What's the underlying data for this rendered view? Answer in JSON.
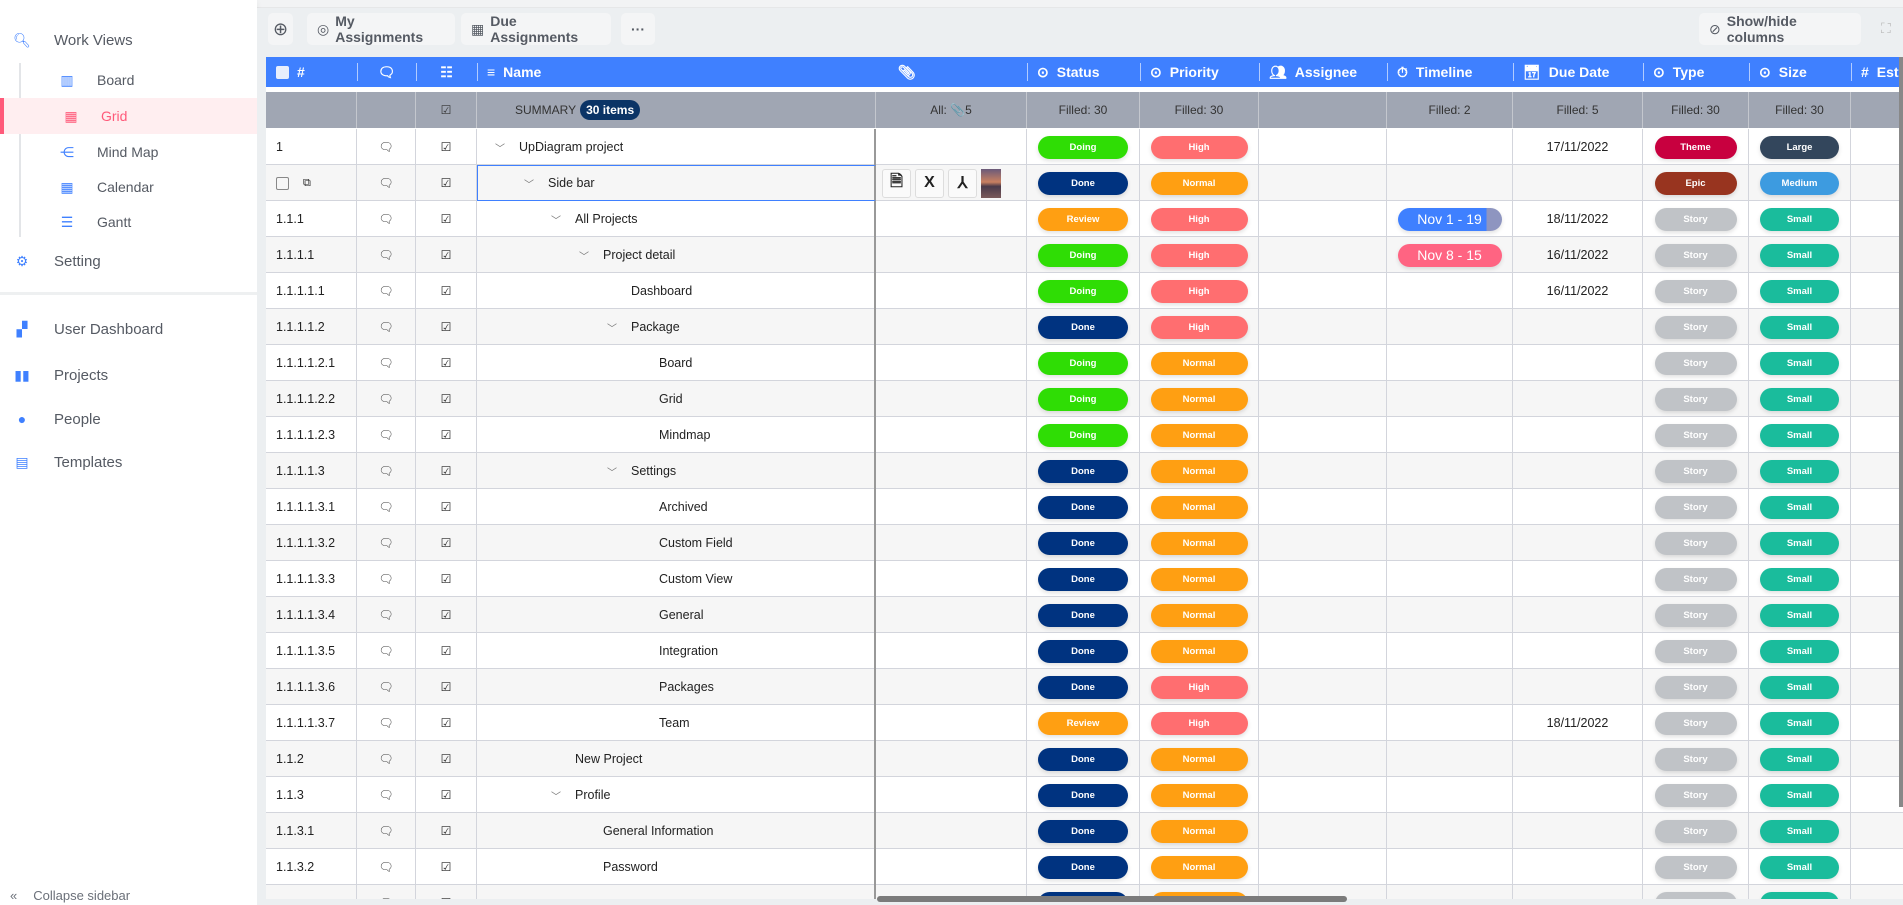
{
  "sidebar": {
    "work_views": "Work Views",
    "views": [
      {
        "label": "Board",
        "icon": "board-icon",
        "glyph": "▥"
      },
      {
        "label": "Grid",
        "icon": "grid-icon",
        "glyph": "▦",
        "active": true
      },
      {
        "label": "Mind Map",
        "icon": "mind-map-icon",
        "glyph": "⋲"
      },
      {
        "label": "Calendar",
        "icon": "calendar-icon",
        "glyph": "▦"
      },
      {
        "label": "Gantt",
        "icon": "gantt-icon",
        "glyph": "☰"
      }
    ],
    "setting": "Setting",
    "items": [
      {
        "label": "User Dashboard",
        "icon": "dashboard-icon",
        "glyph": "▞"
      },
      {
        "label": "Projects",
        "icon": "book-icon",
        "glyph": "▮▮"
      },
      {
        "label": "People",
        "icon": "person-icon",
        "glyph": "●"
      },
      {
        "label": "Templates",
        "icon": "clipboard-icon",
        "glyph": "▤"
      }
    ],
    "collapse": "Collapse sidebar"
  },
  "toolbar": {
    "my_assignments": "My Assignments",
    "due_assignments": "Due Assignments",
    "more": "···",
    "show_hide": "Show/hide columns"
  },
  "columns": {
    "num": "#",
    "name": "Name",
    "status": "Status",
    "priority": "Priority",
    "assignee": "Assignee",
    "timeline": "Timeline",
    "due_date": "Due Date",
    "type": "Type",
    "size": "Size",
    "estimate": "Est"
  },
  "summary": {
    "label": "SUMMARY",
    "items": "30 items",
    "attachments": "All: 📎5",
    "status": "Filled: 30",
    "priority": "Filled: 30",
    "timeline": "Filled: 2",
    "due_date": "Filled: 5",
    "type": "Filled: 30",
    "size": "Filled: 30"
  },
  "colors": {
    "header": "#3f80ff",
    "Doing": "#2fdd05",
    "Done": "#003380",
    "Review": "#ff9f12",
    "High": "#ff6e70",
    "Normal": "#ff9f12",
    "Theme": "#c8003f",
    "Epic": "#98341f",
    "Story": "#c0c3c7",
    "Large": "#33465c",
    "Medium": "#3d9be0",
    "Small": "#1abc9c"
  },
  "rows": [
    {
      "id": "1",
      "name": "UpDiagram project",
      "level": 0,
      "chev": true,
      "status": "Doing",
      "priority": "High",
      "due": "17/11/2022",
      "type": "Theme",
      "size": "Large"
    },
    {
      "id": "",
      "name": "Side bar",
      "level": 1,
      "chev": true,
      "status": "Done",
      "priority": "Normal",
      "type": "Epic",
      "size": "Medium",
      "selected": true,
      "attachments": [
        "document-icon",
        "excel-icon",
        "pdf-icon",
        "image-thumbnail"
      ]
    },
    {
      "id": "1.1.1",
      "name": "All Projects",
      "level": 2,
      "chev": true,
      "status": "Review",
      "priority": "High",
      "timeline": "Nov 1 - 19",
      "timeline_progress": 0.85,
      "due": "18/11/2022",
      "type": "Story",
      "size": "Small"
    },
    {
      "id": "1.1.1.1",
      "name": "Project detail",
      "level": 3,
      "chev": true,
      "status": "Doing",
      "priority": "High",
      "timeline": "Nov 8 - 15",
      "due": "16/11/2022",
      "type": "Story",
      "size": "Small"
    },
    {
      "id": "1.1.1.1.1",
      "name": "Dashboard",
      "level": 4,
      "status": "Doing",
      "priority": "High",
      "due": "16/11/2022",
      "type": "Story",
      "size": "Small"
    },
    {
      "id": "1.1.1.1.2",
      "name": "Package",
      "level": 4,
      "chev": true,
      "status": "Done",
      "priority": "High",
      "type": "Story",
      "size": "Small"
    },
    {
      "id": "1.1.1.1.2.1",
      "name": "Board",
      "level": 5,
      "status": "Doing",
      "priority": "Normal",
      "type": "Story",
      "size": "Small"
    },
    {
      "id": "1.1.1.1.2.2",
      "name": "Grid",
      "level": 5,
      "status": "Doing",
      "priority": "Normal",
      "type": "Story",
      "size": "Small"
    },
    {
      "id": "1.1.1.1.2.3",
      "name": "Mindmap",
      "level": 5,
      "status": "Doing",
      "priority": "Normal",
      "type": "Story",
      "size": "Small"
    },
    {
      "id": "1.1.1.1.3",
      "name": "Settings",
      "level": 4,
      "chev": true,
      "status": "Done",
      "priority": "Normal",
      "type": "Story",
      "size": "Small"
    },
    {
      "id": "1.1.1.1.3.1",
      "name": "Archived",
      "level": 5,
      "status": "Done",
      "priority": "Normal",
      "type": "Story",
      "size": "Small"
    },
    {
      "id": "1.1.1.1.3.2",
      "name": "Custom Field",
      "level": 5,
      "status": "Done",
      "priority": "Normal",
      "type": "Story",
      "size": "Small"
    },
    {
      "id": "1.1.1.1.3.3",
      "name": "Custom View",
      "level": 5,
      "status": "Done",
      "priority": "Normal",
      "type": "Story",
      "size": "Small"
    },
    {
      "id": "1.1.1.1.3.4",
      "name": "General",
      "level": 5,
      "status": "Done",
      "priority": "Normal",
      "type": "Story",
      "size": "Small"
    },
    {
      "id": "1.1.1.1.3.5",
      "name": "Integration",
      "level": 5,
      "status": "Done",
      "priority": "Normal",
      "type": "Story",
      "size": "Small"
    },
    {
      "id": "1.1.1.1.3.6",
      "name": "Packages",
      "level": 5,
      "status": "Done",
      "priority": "High",
      "type": "Story",
      "size": "Small"
    },
    {
      "id": "1.1.1.1.3.7",
      "name": "Team",
      "level": 5,
      "status": "Review",
      "priority": "High",
      "due": "18/11/2022",
      "type": "Story",
      "size": "Small"
    },
    {
      "id": "1.1.2",
      "name": "New Project",
      "level": 2,
      "status": "Done",
      "priority": "Normal",
      "type": "Story",
      "size": "Small"
    },
    {
      "id": "1.1.3",
      "name": "Profile",
      "level": 2,
      "chev": true,
      "status": "Done",
      "priority": "Normal",
      "type": "Story",
      "size": "Small"
    },
    {
      "id": "1.1.3.1",
      "name": "General Information",
      "level": 3,
      "status": "Done",
      "priority": "Normal",
      "type": "Story",
      "size": "Small"
    },
    {
      "id": "1.1.3.2",
      "name": "Password",
      "level": 3,
      "status": "Done",
      "priority": "Normal",
      "type": "Story",
      "size": "Small"
    },
    {
      "id": "",
      "name": "",
      "level": 0,
      "status": "Done",
      "priority": "Normal",
      "type": "Story",
      "size": "Small"
    }
  ]
}
